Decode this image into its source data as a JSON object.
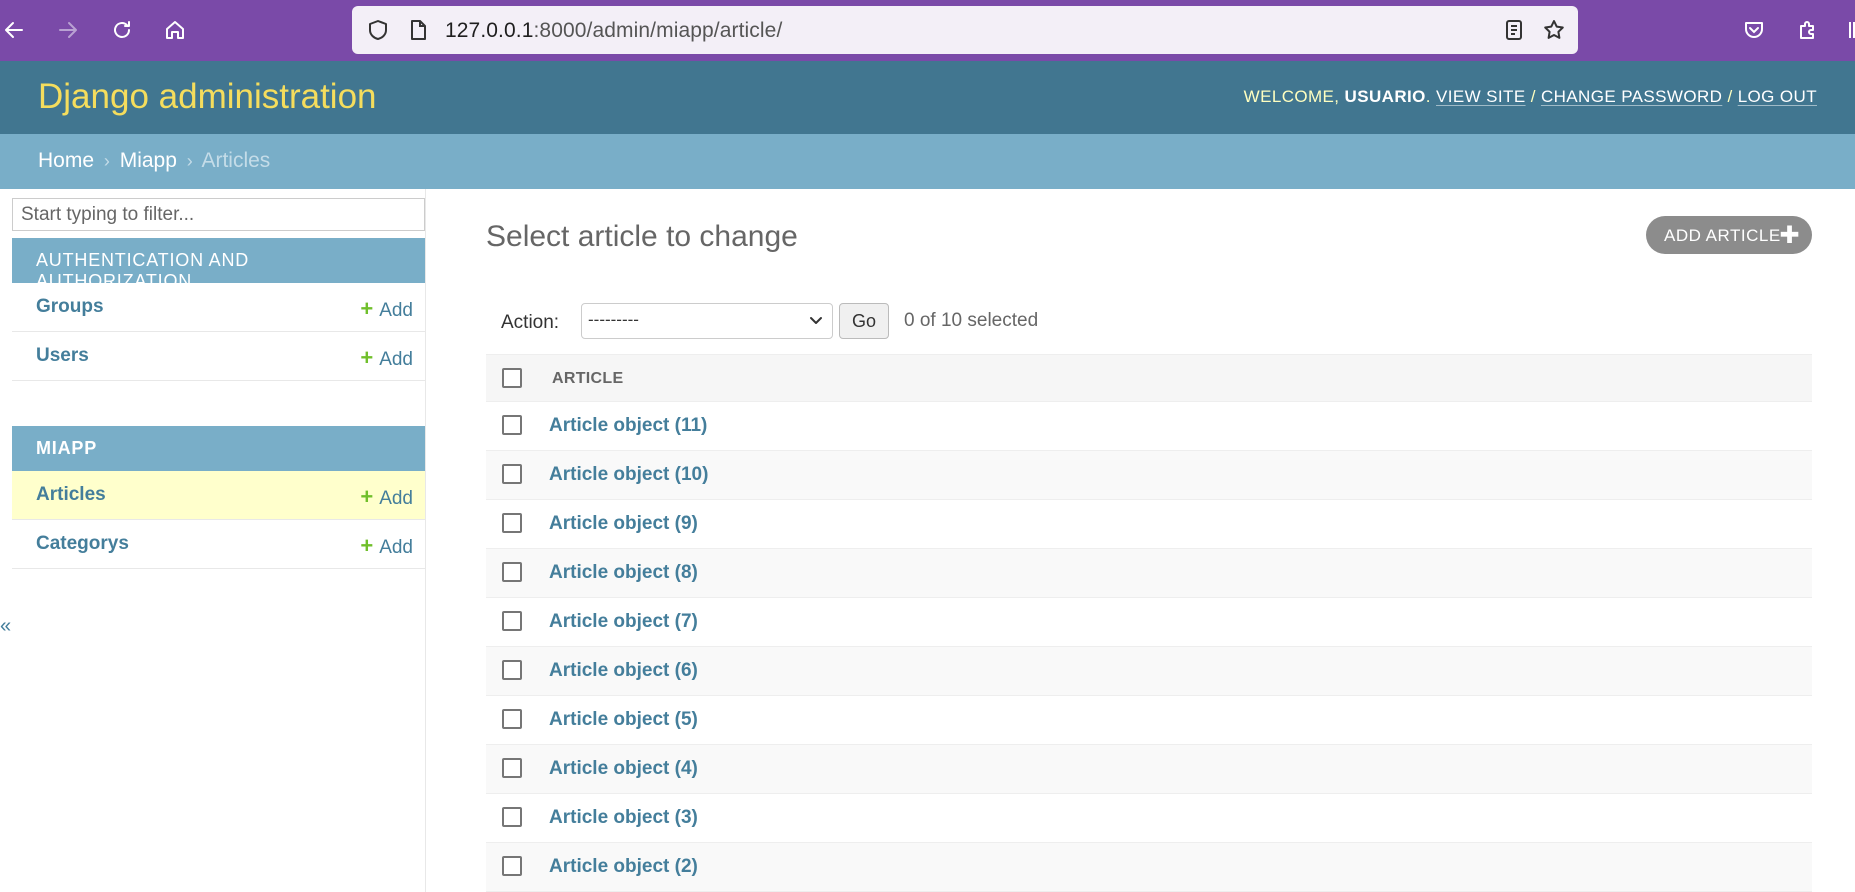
{
  "browser": {
    "url_host": "127.0.0.1",
    "url_rest": ":8000/admin/miapp/article/"
  },
  "header": {
    "branding": "Django administration",
    "welcome": "WELCOME,",
    "username": "USUARIO",
    "view_site": "VIEW SITE",
    "change_password": "CHANGE PASSWORD",
    "log_out": "LOG OUT",
    "separator": "/"
  },
  "breadcrumbs": {
    "home": "Home",
    "app": "Miapp",
    "current": "Articles",
    "separator": "›"
  },
  "sidebar": {
    "filter_placeholder": "Start typing to filter...",
    "auth_caption": "AUTHENTICATION AND AUTHORIZATION",
    "auth_items": [
      {
        "name": "Groups",
        "add": "Add"
      },
      {
        "name": "Users",
        "add": "Add"
      }
    ],
    "miapp_caption": "MIAPP",
    "miapp_items": [
      {
        "name": "Articles",
        "add": "Add"
      },
      {
        "name": "Categorys",
        "add": "Add"
      }
    ],
    "collapse_glyph": "«"
  },
  "content": {
    "title": "Select article to change",
    "add_button": "ADD ARTICLE",
    "add_glyph": "✚",
    "action_label": "Action:",
    "action_selected": "---------",
    "go_button": "Go",
    "selected_counter": "0 of 10 selected",
    "column_header": "ARTICLE",
    "rows": [
      "Article object (11)",
      "Article object (10)",
      "Article object (9)",
      "Article object (8)",
      "Article object (7)",
      "Article object (6)",
      "Article object (5)",
      "Article object (4)",
      "Article object (3)",
      "Article object (2)"
    ]
  },
  "colors": {
    "browser_bar": "#7a4aa8",
    "header": "#417690",
    "branding": "#f5dd5d",
    "breadcrumbs": "#79aec8",
    "link": "#447e9b",
    "add_plus": "#70bf2b",
    "current_row": "#ffffcc"
  }
}
